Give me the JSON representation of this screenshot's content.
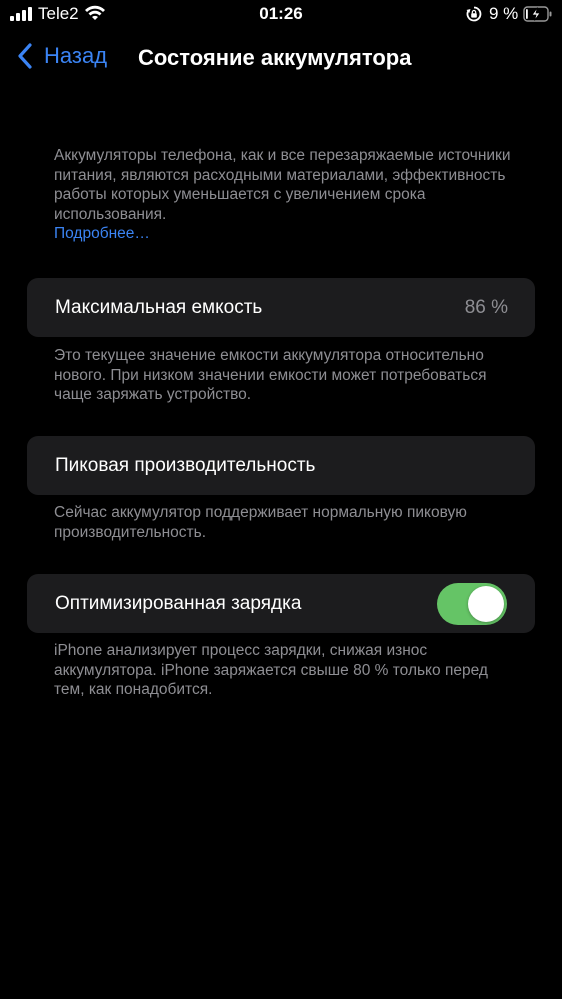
{
  "status_bar": {
    "carrier": "Tele2",
    "time": "01:26",
    "battery_percent": "9 %",
    "battery_level": 0.09,
    "charging": true
  },
  "nav": {
    "back_label": "Назад",
    "title": "Состояние аккумулятора"
  },
  "intro": {
    "text": "Аккумуляторы телефона, как и все перезаряжаемые источники питания, являются расходными материалами, эффективность работы которых уменьшается с увеличением срока использования.",
    "link": "Подробнее…"
  },
  "max_capacity": {
    "label": "Максимальная емкость",
    "value": "86 %",
    "footnote": "Это текущее значение емкости аккумулятора относительно нового. При низком значении емкости может потребоваться чаще заряжать устройство."
  },
  "peak_performance": {
    "label": "Пиковая производительность",
    "footnote": "Сейчас аккумулятор поддерживает нормальную пиковую производительность."
  },
  "optimized_charging": {
    "label": "Оптимизированная зарядка",
    "enabled": true,
    "footnote": "iPhone анализирует процесс зарядки, снижая износ аккумулятора. iPhone заряжается свыше 80 % только перед тем, как понадобится."
  },
  "colors": {
    "background": "#000000",
    "cell": "#1c1c1e",
    "accent_blue": "#3b84f4",
    "secondary_text": "#8e8e93",
    "toggle_on": "#65c466"
  }
}
